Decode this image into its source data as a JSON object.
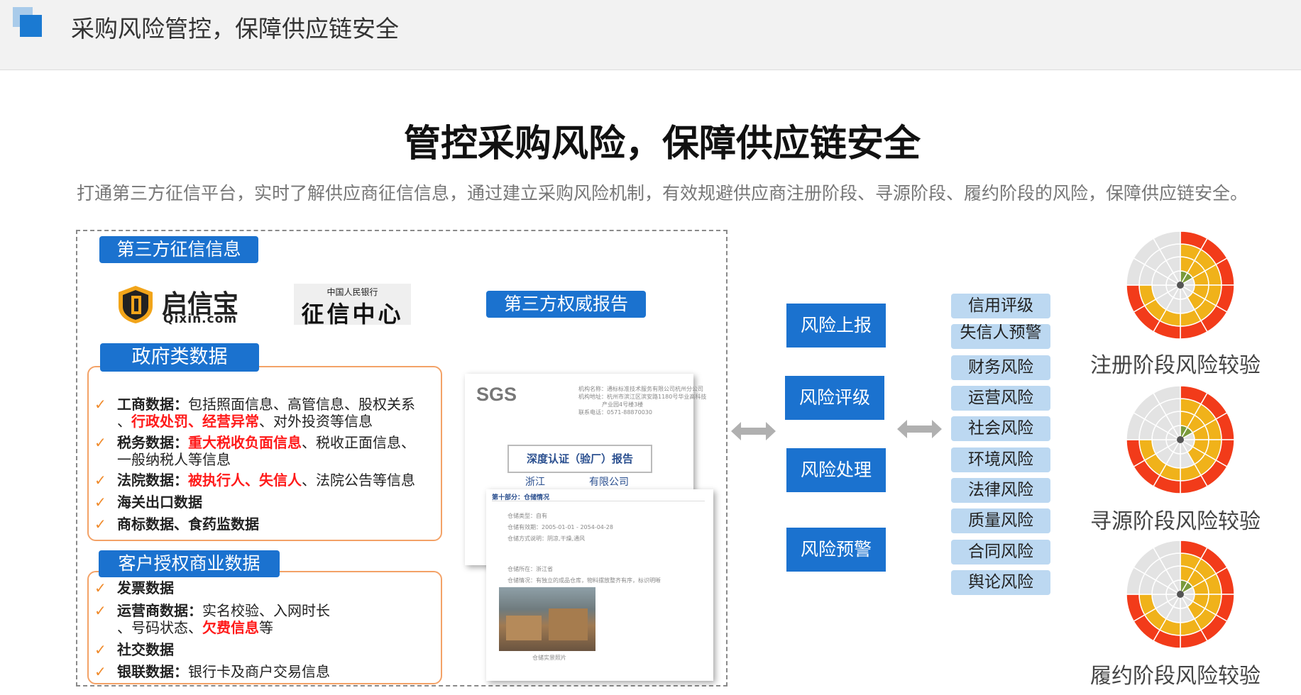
{
  "header": {
    "title": "采购风险管控，保障供应链安全"
  },
  "main": {
    "title": "管控采购风险，保障供应链安全",
    "subtitle": "打通第三方征信平台，实时了解供应商征信信息，通过建立采购风险机制，有效规避供应商注册阶段、寻源阶段、履约阶段的风险，保障供应链安全。"
  },
  "third_party": {
    "tab": "第三方征信信息",
    "qixin_name": "启信宝",
    "qixin_domain": "Qixin.com",
    "pbc_small": "中国人民银行",
    "pbc_name": "征信中心",
    "report_tab": "第三方权威报告"
  },
  "gov": {
    "tab": "政府类数据",
    "items": [
      {
        "label": "工商数据",
        "sep": "：",
        "t1": "包括照面信息、高管信息、股权关系",
        "t2": "、",
        "r1": "行政处罚",
        "t3": "、",
        "r2": "经营异常",
        "t4": "、对外投资等信息"
      },
      {
        "label": "税务数据",
        "sep": "：",
        "r1": "重大税收负面信息",
        "t1": "、税收正面信息、",
        "t2": "一般纳税人等信息"
      },
      {
        "label": "法院数据",
        "sep": "：",
        "r1": "被执行人",
        "t1": "、",
        "r2": "失信人",
        "t2": "、法院公告等信息"
      },
      {
        "label": "海关出口数据"
      },
      {
        "label": "商标数据、食药监数据"
      }
    ]
  },
  "customer": {
    "tab": "客户授权商业数据",
    "items": [
      {
        "label": "发票数据"
      },
      {
        "label": "运营商数据",
        "sep": "：",
        "t1": "实名校验、入网时长",
        "t2": "、号码状态、",
        "r1": "欠费信息",
        "t3": "等"
      },
      {
        "label": "社交数据"
      },
      {
        "label": "银联数据",
        "sep": "：",
        "t1": "银行卡及商户交易信息"
      }
    ]
  },
  "report": {
    "logo": "SGS",
    "rows": [
      {
        "k": "机构名称：",
        "v": "通标标准技术服务有限公司杭州分公司"
      },
      {
        "k": "机构地址：",
        "v": "杭州市滨江区滨安路1180号华业高科技"
      },
      {
        "k": "",
        "v": "产业园4号楼3楼"
      },
      {
        "k": "联系电话：",
        "v": "0571-88870030"
      }
    ],
    "title": "深度认证（验厂）报告",
    "company_left": "浙江",
    "company_right": "有限公司",
    "section": "第十部分：仓储情况",
    "fields": [
      {
        "k": "仓储类型：",
        "v": "自有"
      },
      {
        "k": "仓储有效期：",
        "v": "2005-01-01 - 2054-04-28"
      },
      {
        "k": "仓储方式说明：",
        "v": "阴凉,干燥,通风"
      },
      {
        "k": "仓储所在：",
        "v": "浙江省"
      },
      {
        "k": "仓储情况：",
        "v": "有独立的成品仓库，物料摆放整齐有序，标识明晰"
      }
    ],
    "caption": "仓储实景照片"
  },
  "actions": [
    "风险上报",
    "风险评级",
    "风险处理",
    "风险预警"
  ],
  "risks": [
    "信用评级",
    "失信人预警",
    "财务风险",
    "运营风险",
    "社会风险",
    "环境风险",
    "法律风险",
    "质量风险",
    "合同风险",
    "舆论风险"
  ],
  "stages": [
    "注册阶段风险较验",
    "寻源阶段风险较验",
    "履约阶段风险较验"
  ],
  "colors": {
    "brand_blue": "#1b72cf",
    "tag_blue": "#bcd8f1",
    "orange": "#f3a267",
    "red": "#ff1a1a",
    "chart_red": "#f23b1a",
    "chart_yellow": "#f0b21a",
    "chart_green": "#7a9a3a",
    "chart_grey": "#e3e3e3"
  }
}
